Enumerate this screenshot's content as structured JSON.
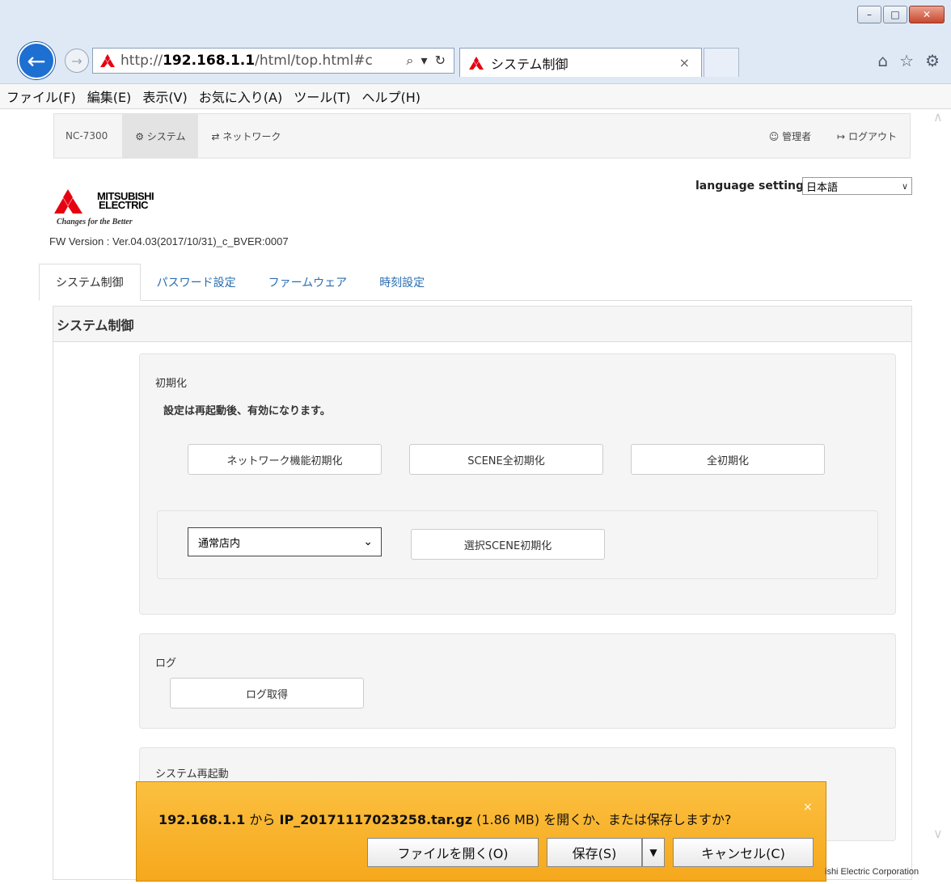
{
  "browser": {
    "address_pre": "http://",
    "address_host": "192.168.1.1",
    "address_path": "/html/top.html#c",
    "address_tools": "⌕ ▾ ↻",
    "tab_title": "システム制御",
    "tab_close": "×"
  },
  "menubar": [
    "ファイル(F)",
    "編集(E)",
    "表示(V)",
    "お気に入り(A)",
    "ツール(T)",
    "ヘルプ(H)"
  ],
  "nav": {
    "brand": "NC-7300",
    "system": "⚙ システム",
    "network": "⇄ ネットワーク",
    "admin": "☺ 管理者",
    "logout": "↦ ログアウト"
  },
  "language": {
    "label": "language setting",
    "selected": "日本語"
  },
  "logo": {
    "line1": "MITSUBISHI",
    "line2": "ELECTRIC",
    "tagline": "Changes for the Better"
  },
  "fw_version": "FW Version : Ver.04.03(2017/10/31)_c_BVER:0007",
  "tabs": [
    "システム制御",
    "パスワード設定",
    "ファームウェア",
    "時刻設定"
  ],
  "panel_title": "システム制御",
  "init": {
    "title": "初期化",
    "note": "設定は再起動後、有効になります。",
    "btn_network": "ネットワーク機能初期化",
    "btn_scene_all": "SCENE全初期化",
    "btn_all": "全初期化",
    "scene_selected": "通常店内",
    "btn_scene_selected": "選択SCENE初期化"
  },
  "log": {
    "title": "ログ",
    "btn": "ログ取得"
  },
  "reboot": {
    "title": "システム再起動"
  },
  "download": {
    "host": "192.168.1.1",
    "from": " から ",
    "filename": "IP_20171117023258.tar.gz",
    "size": " (1.86 MB) ",
    "question": "を開くか、または保存しますか?",
    "close": "×",
    "btn_open": "ファイルを開く(O)",
    "btn_save": "保存(S)",
    "btn_save_dropdown": "▼",
    "btn_cancel": "キャンセル(C)"
  },
  "footer": "ishi Electric Corporation"
}
